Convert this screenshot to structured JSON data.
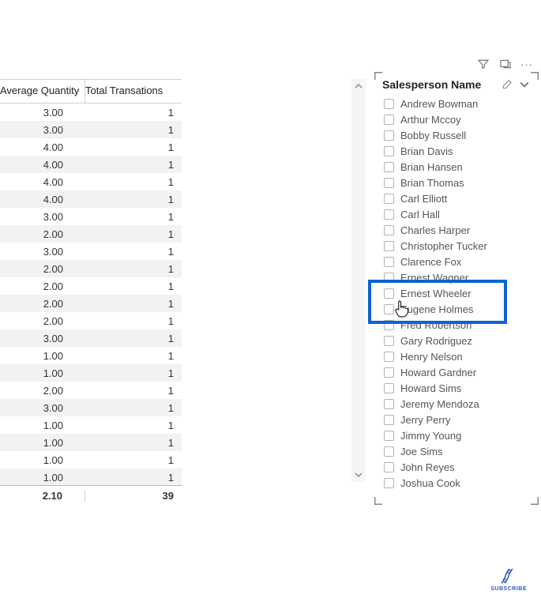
{
  "table": {
    "headers": {
      "qty": "Average Quantity",
      "trn": "Total Transations"
    },
    "rows": [
      {
        "qty": "3.00",
        "trn": "1"
      },
      {
        "qty": "3.00",
        "trn": "1"
      },
      {
        "qty": "4.00",
        "trn": "1"
      },
      {
        "qty": "4.00",
        "trn": "1"
      },
      {
        "qty": "4.00",
        "trn": "1"
      },
      {
        "qty": "4.00",
        "trn": "1"
      },
      {
        "qty": "3.00",
        "trn": "1"
      },
      {
        "qty": "2.00",
        "trn": "1"
      },
      {
        "qty": "3.00",
        "trn": "1"
      },
      {
        "qty": "2.00",
        "trn": "1"
      },
      {
        "qty": "2.00",
        "trn": "1"
      },
      {
        "qty": "2.00",
        "trn": "1"
      },
      {
        "qty": "2.00",
        "trn": "1"
      },
      {
        "qty": "3.00",
        "trn": "1"
      },
      {
        "qty": "1.00",
        "trn": "1"
      },
      {
        "qty": "1.00",
        "trn": "1"
      },
      {
        "qty": "2.00",
        "trn": "1"
      },
      {
        "qty": "3.00",
        "trn": "1"
      },
      {
        "qty": "1.00",
        "trn": "1"
      },
      {
        "qty": "1.00",
        "trn": "1"
      },
      {
        "qty": "1.00",
        "trn": "1"
      },
      {
        "qty": "1.00",
        "trn": "1"
      }
    ],
    "footer": {
      "qty": "2.10",
      "trn": "39"
    }
  },
  "slicer": {
    "title": "Salesperson Name",
    "items": [
      "Andrew Bowman",
      "Arthur Mccoy",
      "Bobby Russell",
      "Brian Davis",
      "Brian Hansen",
      "Brian Thomas",
      "Carl Elliott",
      "Carl Hall",
      "Charles Harper",
      "Christopher Tucker",
      "Clarence Fox",
      "Ernest Wagner",
      "Ernest Wheeler",
      "Eugene Holmes",
      "Fred Robertson",
      "Gary Rodriguez",
      "Henry Nelson",
      "Howard Gardner",
      "Howard Sims",
      "Jeremy Mendoza",
      "Jerry Perry",
      "Jimmy Young",
      "Joe Sims",
      "John Reyes",
      "Joshua Cook"
    ]
  },
  "watermark": {
    "label": "SUBSCRIBE"
  }
}
